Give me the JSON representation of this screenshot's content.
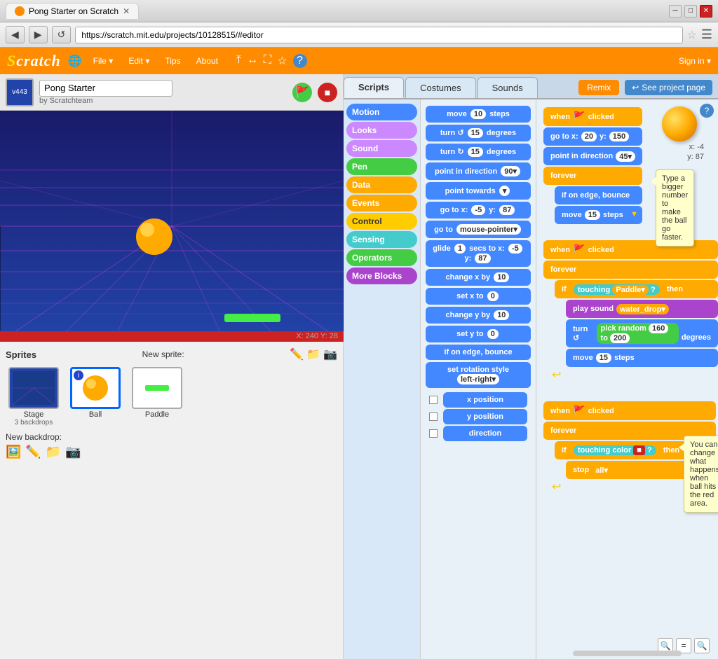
{
  "browser": {
    "tab_title": "Pong Starter on Scratch",
    "url": "https://scratch.mit.edu/projects/10128515/#editor",
    "back_btn": "◀",
    "forward_btn": "▶",
    "refresh_btn": "↺"
  },
  "scratch": {
    "logo": "Scratch",
    "menu_items": [
      "File",
      "Edit",
      "Tips",
      "About"
    ],
    "topbar_icons": [
      "🌐",
      "▼",
      "⤒",
      "↔",
      "⛶",
      "☆",
      "?"
    ],
    "sign_in": "Sign in ▾"
  },
  "project": {
    "name": "Pong Starter",
    "author": "by Scratchteam",
    "version": "v443"
  },
  "tabs": {
    "scripts_label": "Scripts",
    "costumes_label": "Costumes",
    "sounds_label": "Sounds",
    "remix_label": "Remix",
    "see_project_label": "See project page"
  },
  "categories": [
    {
      "id": "motion",
      "label": "Motion",
      "color": "cat-motion"
    },
    {
      "id": "looks",
      "label": "Looks",
      "color": "cat-looks"
    },
    {
      "id": "sound",
      "label": "Sound",
      "color": "cat-sound"
    },
    {
      "id": "pen",
      "label": "Pen",
      "color": "cat-pen"
    },
    {
      "id": "data",
      "label": "Data",
      "color": "cat-data"
    },
    {
      "id": "events",
      "label": "Events",
      "color": "cat-events"
    },
    {
      "id": "control",
      "label": "Control",
      "color": "cat-control"
    },
    {
      "id": "sensing",
      "label": "Sensing",
      "color": "cat-sensing"
    },
    {
      "id": "operators",
      "label": "Operators",
      "color": "cat-operators"
    },
    {
      "id": "moreblocks",
      "label": "More Blocks",
      "color": "cat-moreblocks"
    }
  ],
  "palette_blocks": [
    {
      "label": "move 10 steps",
      "type": "blue"
    },
    {
      "label": "turn ↺ 15 degrees",
      "type": "blue"
    },
    {
      "label": "turn ↻ 15 degrees",
      "type": "blue"
    },
    {
      "label": "point in direction 90▾",
      "type": "blue"
    },
    {
      "label": "point towards ▾",
      "type": "blue"
    },
    {
      "label": "go to x: -5 y: 87",
      "type": "blue"
    },
    {
      "label": "go to mouse-pointer ▾",
      "type": "blue"
    },
    {
      "label": "glide 1 secs to x: -5 y: 87",
      "type": "blue"
    },
    {
      "label": "change x by 10",
      "type": "blue"
    },
    {
      "label": "set x to 0",
      "type": "blue"
    },
    {
      "label": "change y by 10",
      "type": "blue"
    },
    {
      "label": "set y to 0",
      "type": "blue"
    },
    {
      "label": "if on edge, bounce",
      "type": "blue"
    },
    {
      "label": "set rotation style left-right ▾",
      "type": "blue"
    },
    {
      "label": "x position",
      "type": "checkbox"
    },
    {
      "label": "y position",
      "type": "checkbox"
    },
    {
      "label": "direction",
      "type": "checkbox"
    }
  ],
  "sprites": {
    "header": "Sprites",
    "new_sprite_label": "New sprite:",
    "stage_name": "Stage",
    "stage_backdrops": "3 backdrops",
    "new_backdrop_label": "New backdrop:",
    "items": [
      {
        "name": "Ball",
        "selected": true
      },
      {
        "name": "Paddle",
        "selected": false
      }
    ]
  },
  "stage": {
    "coords": "X: 240 Y: 28"
  },
  "workspace": {
    "stack1": {
      "blocks": [
        {
          "text": "when 🚩 clicked",
          "type": "orange"
        },
        {
          "text": "go to x: 20  y: 150",
          "type": "blue"
        },
        {
          "text": "point in direction 45▾",
          "type": "blue"
        },
        {
          "text": "forever",
          "type": "orange"
        },
        {
          "text": "if on edge, bounce",
          "type": "blue",
          "indent": true
        },
        {
          "text": "move 15 steps",
          "type": "blue",
          "indent": true
        }
      ],
      "tooltip": "Type a bigger number to make the ball go faster."
    },
    "stack2": {
      "blocks": [
        {
          "text": "when 🚩 clicked",
          "type": "orange"
        },
        {
          "text": "forever",
          "type": "orange"
        },
        {
          "text": "if  touching Paddle▾ ?  then",
          "type": "orange",
          "indent": false
        },
        {
          "text": "play sound water_drop▾",
          "type": "purple",
          "indent": true
        },
        {
          "text": "turn ↺  pick random 160 to 200  degrees",
          "type": "blue",
          "indent": true
        },
        {
          "text": "move 15 steps",
          "type": "blue",
          "indent": true
        }
      ]
    },
    "stack3": {
      "blocks": [
        {
          "text": "when 🚩 clicked",
          "type": "orange"
        },
        {
          "text": "forever",
          "type": "orange"
        },
        {
          "text": "if  touching color 🟥 ?  then",
          "type": "orange",
          "indent": false
        },
        {
          "text": "stop all▾",
          "type": "orange",
          "indent": true
        }
      ],
      "tooltip": "You can change what happens when ball hits the red area."
    }
  },
  "zoom_controls": {
    "zoom_out": "🔍",
    "zoom_equal": "=",
    "zoom_in": "🔍"
  }
}
